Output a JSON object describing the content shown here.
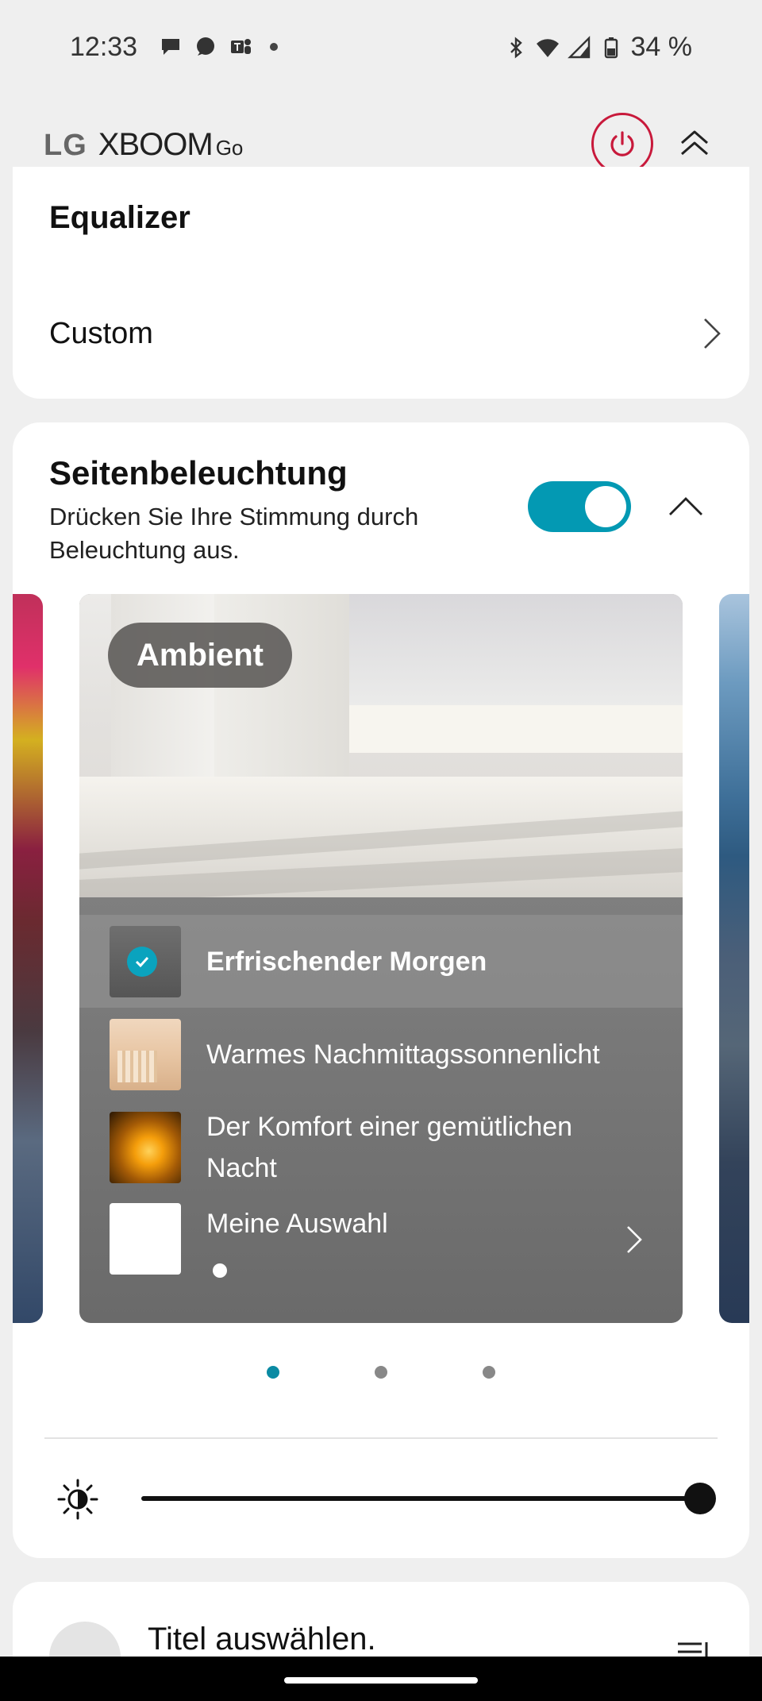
{
  "status_bar": {
    "time": "12:33",
    "battery": "34 %",
    "icons": [
      "chat-icon",
      "message-icon",
      "teams-icon",
      "notification-dot",
      "bluetooth-icon",
      "wifi-icon",
      "signal-icon",
      "battery-icon"
    ]
  },
  "header": {
    "brand_lg": "LG",
    "brand_name": "XBOOM",
    "brand_go": "Go",
    "accent": "#c8193b"
  },
  "equalizer": {
    "title": "Equalizer",
    "mode": "Custom"
  },
  "lighting": {
    "title": "Seitenbeleuchtung",
    "description": "Drücken Sie Ihre Stimmung durch Beleuchtung aus.",
    "enabled": true,
    "toggle_color": "#0399b3",
    "carousel": {
      "badge": "Ambient",
      "items": [
        {
          "label": "Erfrischender Morgen",
          "selected": true
        },
        {
          "label": "Warmes Nachmittagssonnenlicht",
          "selected": false
        },
        {
          "label": "Der Komfort einer gemütlichen Nacht",
          "selected": false
        },
        {
          "label": "Meine Auswahl",
          "selected": false
        }
      ],
      "page_count": 3,
      "current_page": 1
    },
    "brightness_level": 1.0
  },
  "player": {
    "title": "Titel auswählen."
  }
}
